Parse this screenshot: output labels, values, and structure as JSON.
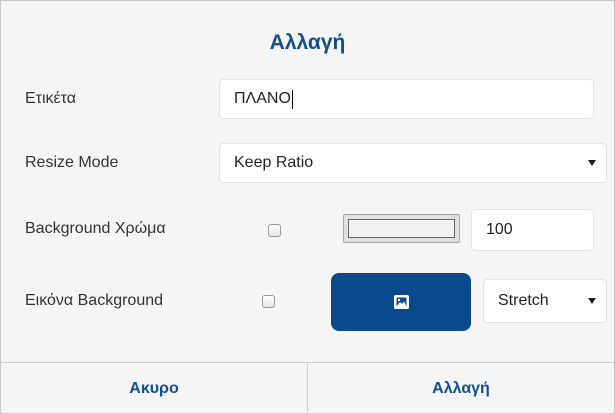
{
  "dialog": {
    "title": "Αλλαγή"
  },
  "fields": {
    "label": {
      "name": "Ετικέτα",
      "value": "ΠΛΑΝΟ"
    },
    "resize_mode": {
      "name": "Resize Mode",
      "selected": "Keep Ratio"
    },
    "background_color": {
      "name": "Background Χρώμα",
      "checked": false,
      "opacity": "100"
    },
    "background_image": {
      "name": "Εικόνα Background",
      "checked": false,
      "button_icon": "image-icon",
      "mode": "Stretch"
    }
  },
  "footer": {
    "cancel_label": "Ακυρο",
    "confirm_label": "Αλλαγή"
  },
  "colors": {
    "accent": "#10508f",
    "button": "#094a8c",
    "background": "#f5f5f5"
  }
}
